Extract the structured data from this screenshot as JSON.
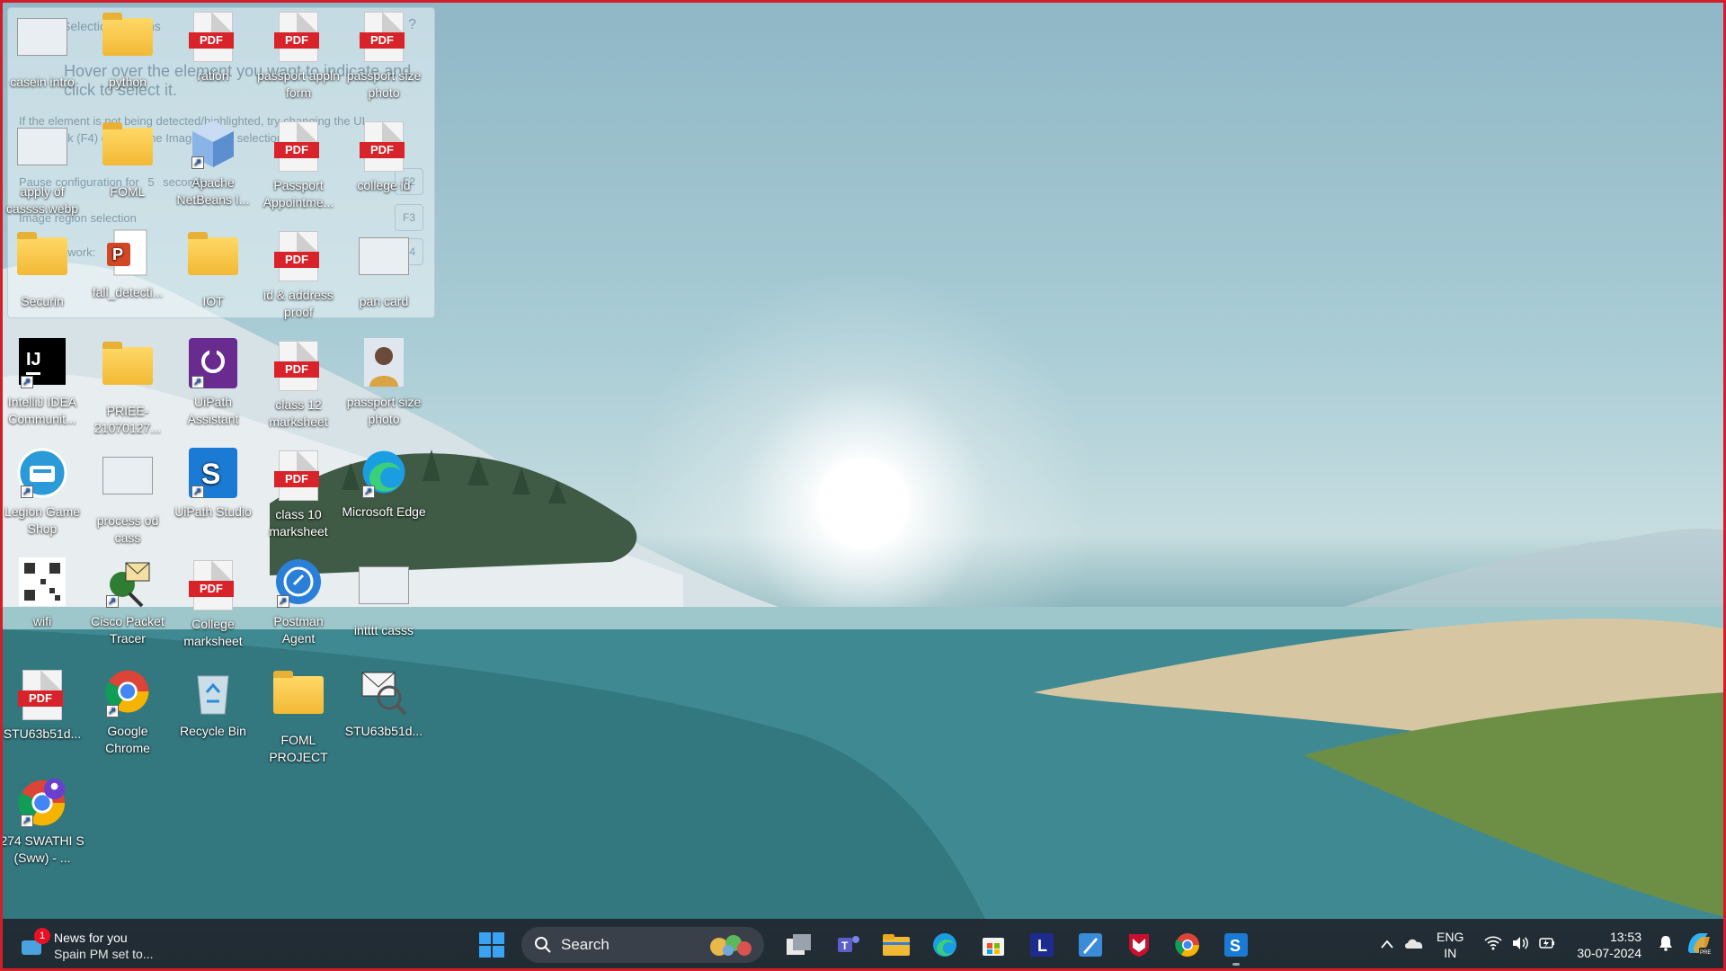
{
  "dialog": {
    "title": "Selection Options",
    "help": "?",
    "hint": "Hover over the element you want to indicate and click to select it.",
    "note": "If the element is not being detected/highlighted, try changing the UI framework (F4) or using the Image region selection (F3).",
    "row1": "Pause configuration for",
    "row1_value": "5",
    "row1_unit": "seconds",
    "row1_key": "F2",
    "row2": "Image region selection",
    "row2_key": "F3",
    "row3": "UI Framework:",
    "row3_key": "F4"
  },
  "desktop": {
    "icons": [
      {
        "label": "casein intro",
        "type": "thumb"
      },
      {
        "label": "python",
        "type": "folder"
      },
      {
        "label": "ration",
        "type": "pdf"
      },
      {
        "label": "passport appln form",
        "type": "pdf"
      },
      {
        "label": "passport size photo",
        "type": "pdf"
      },
      {
        "label": "apply of cassss.webp",
        "type": "thumb"
      },
      {
        "label": "FOML",
        "type": "folder"
      },
      {
        "label": "Apache NetBeans I...",
        "type": "netbeans"
      },
      {
        "label": "Passport Appointme...",
        "type": "pdf"
      },
      {
        "label": "college id",
        "type": "pdf"
      },
      {
        "label": "Securin",
        "type": "folder"
      },
      {
        "label": "fall_detecti...",
        "type": "ppt"
      },
      {
        "label": "IOT",
        "type": "folder"
      },
      {
        "label": "id & address proof",
        "type": "pdf"
      },
      {
        "label": "pan card",
        "type": "thumb"
      },
      {
        "label": "IntelliJ IDEA Communit...",
        "type": "intellij"
      },
      {
        "label": "PRIEE-21070127...",
        "type": "folder"
      },
      {
        "label": "UiPath Assistant",
        "type": "uipath"
      },
      {
        "label": "class 12 marksheet",
        "type": "pdf"
      },
      {
        "label": "passport size photo",
        "type": "photo"
      },
      {
        "label": "Legion Game Shop",
        "type": "legion"
      },
      {
        "label": "process od cass",
        "type": "thumb"
      },
      {
        "label": "UiPath Studio",
        "type": "uistudio"
      },
      {
        "label": "class 10 marksheet",
        "type": "pdf"
      },
      {
        "label": "Microsoft Edge",
        "type": "edge"
      },
      {
        "label": "wifi",
        "type": "qr"
      },
      {
        "label": "Cisco Packet Tracer",
        "type": "cisco"
      },
      {
        "label": "College marksheet",
        "type": "pdf"
      },
      {
        "label": "Postman Agent",
        "type": "postman"
      },
      {
        "label": "intttt casss",
        "type": "thumb"
      },
      {
        "label": "STU63b51d...",
        "type": "pdf"
      },
      {
        "label": "Google Chrome",
        "type": "chrome"
      },
      {
        "label": "Recycle Bin",
        "type": "recycle"
      },
      {
        "label": "FOML PROJECT",
        "type": "folder"
      },
      {
        "label": "STU63b51d...",
        "type": "mail"
      },
      {
        "label": "274 SWATHI S (Sww) - ...",
        "type": "chromeprofile"
      }
    ]
  },
  "taskbar": {
    "news_badge": "1",
    "news_title": "News for you",
    "news_sub": "Spain PM set to...",
    "search_label": "Search",
    "lang_line1": "ENG",
    "lang_line2": "IN",
    "time": "13:53",
    "date": "30-07-2024",
    "pinned": [
      "windows-start",
      "task-view",
      "teams",
      "file-explorer",
      "edge",
      "store",
      "lenovo",
      "uipath-blue",
      "mcafee",
      "chrome",
      "uipath-studio"
    ]
  },
  "colors": {
    "frame": "#d01f2a",
    "pdf_tag": "#d8232a",
    "taskbar": "#20262e"
  }
}
